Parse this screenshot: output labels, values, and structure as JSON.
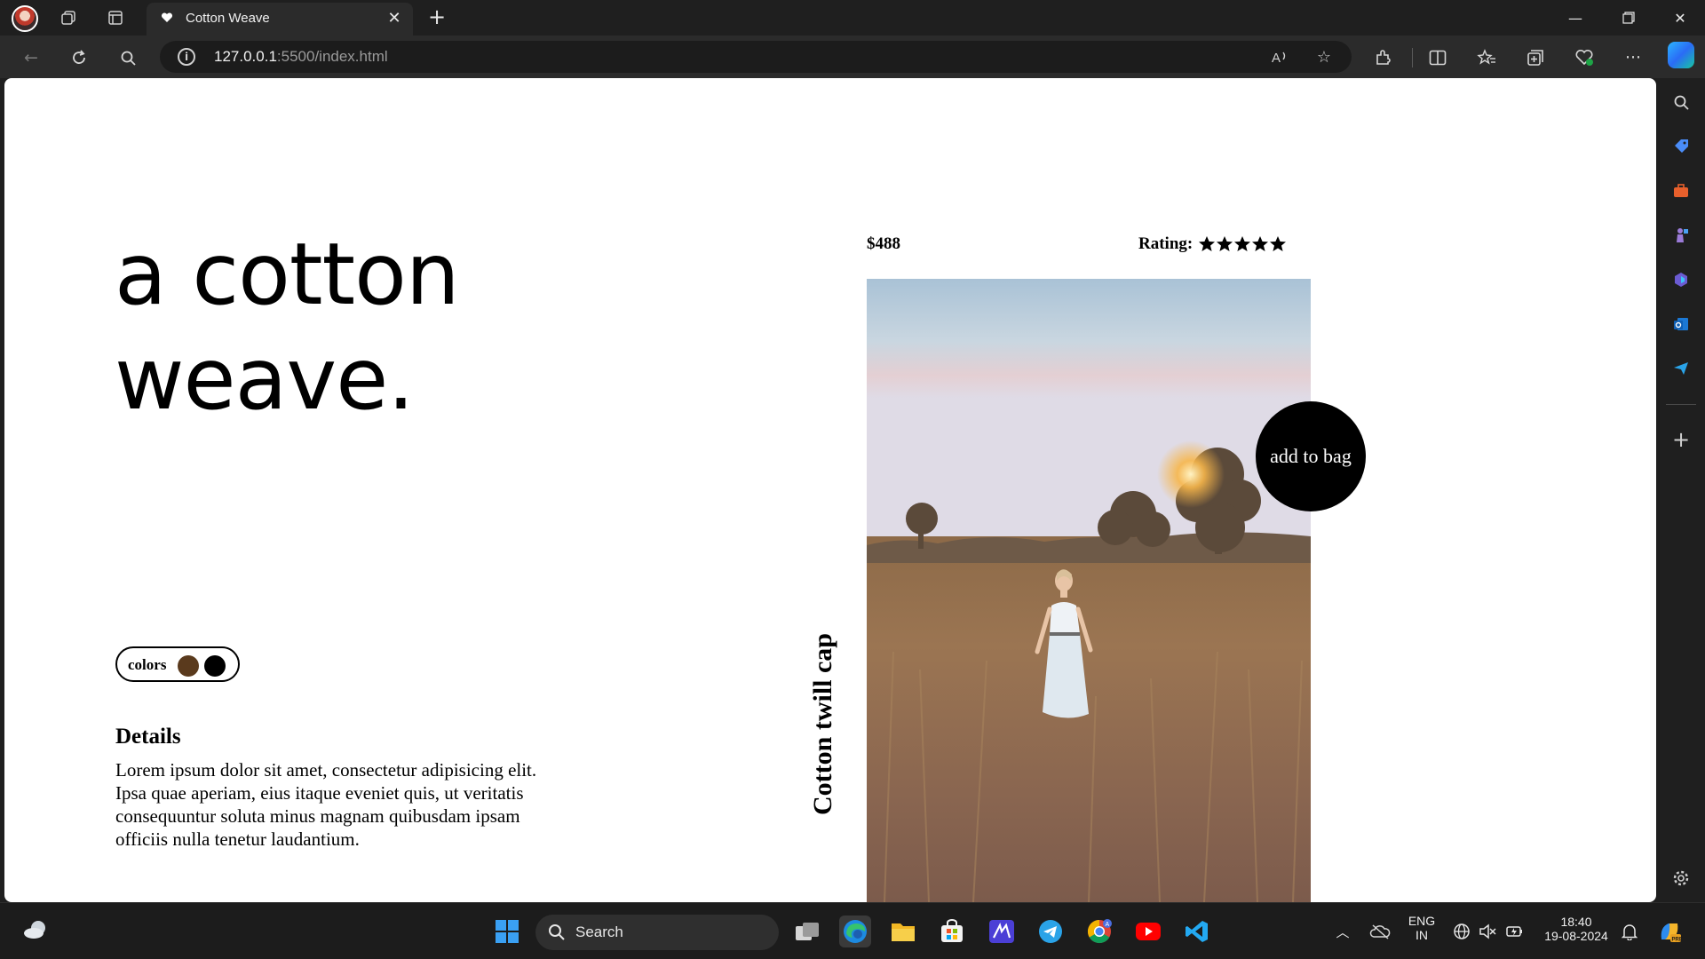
{
  "browser": {
    "tab": {
      "title": "Cotton Weave"
    },
    "url": {
      "host": "127.0.0.1",
      "path": ":5500/index.html"
    }
  },
  "page": {
    "hero": {
      "line1": "a cotton",
      "line2": "weave."
    },
    "colors": {
      "label": "colors",
      "swatches": [
        "#5a3a1d",
        "#000000"
      ]
    },
    "details": {
      "heading": "Details",
      "body": "Lorem ipsum dolor sit amet, consectetur adipisicing elit. Ipsa quae aperiam, eius itaque eveniet quis, ut veritatis consequuntur soluta minus magnam quibusdam ipsam officiis nulla tenetur laudantium."
    },
    "product": {
      "price": "$488",
      "rating_label": "Rating:",
      "rating_stars": 5,
      "name": "Cotton twill cap",
      "add_to_bag": "add to bag"
    }
  },
  "taskbar": {
    "search_label": "Search",
    "lang_line1": "ENG",
    "lang_line2": "IN",
    "time": "18:40",
    "date": "19-08-2024"
  },
  "colors": {
    "accent_black": "#000000",
    "brown_swatch": "#5a3a1d"
  }
}
